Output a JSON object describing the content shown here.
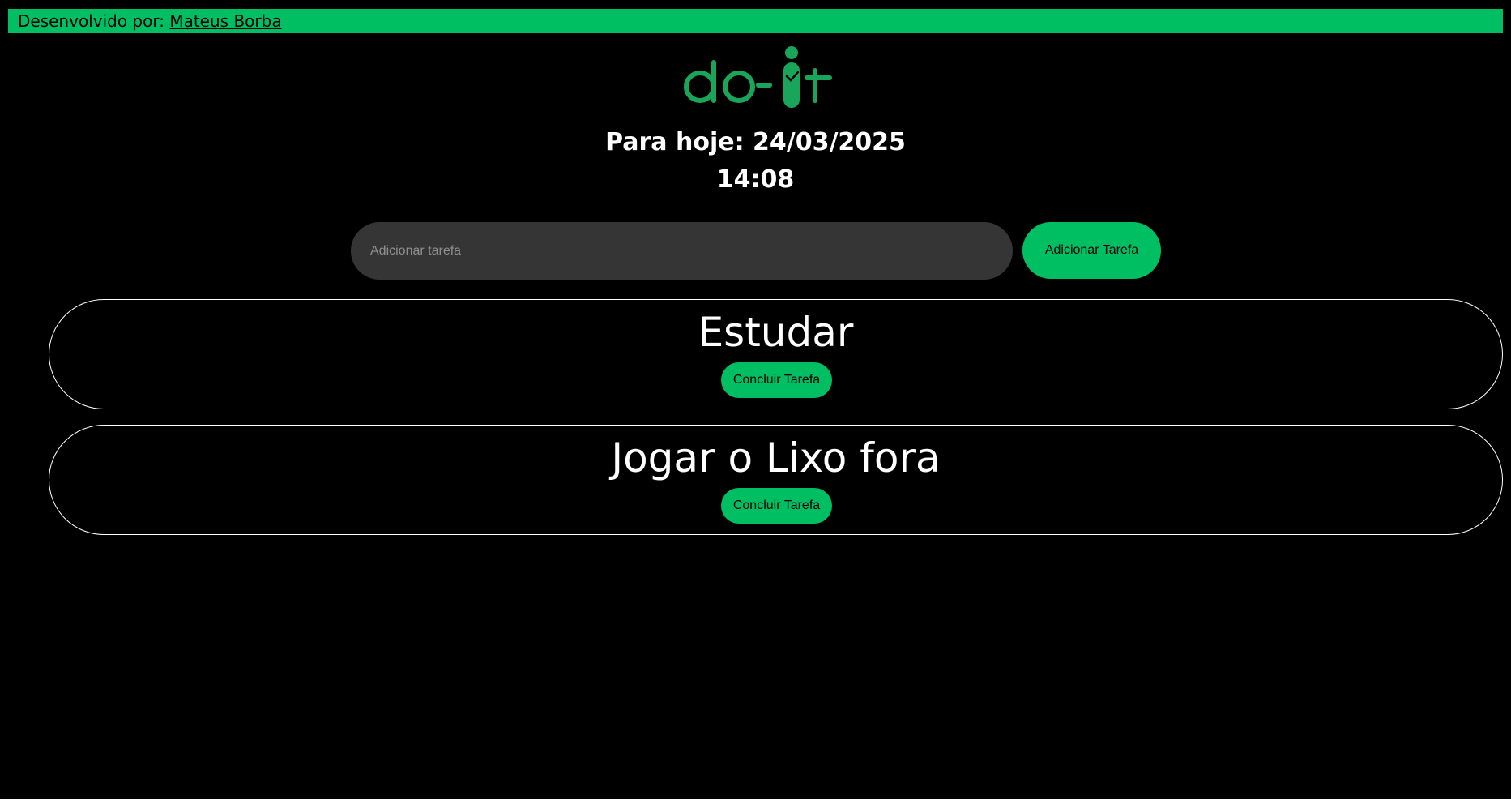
{
  "credit": {
    "prefix": "Desenvolvido por: ",
    "author": "Mateus Borba"
  },
  "logo": {
    "text": "do-it",
    "color": "#1aa65a"
  },
  "header": {
    "date_line": "Para hoje: 24/03/2025",
    "time_line": "14:08"
  },
  "form": {
    "input_value": "",
    "input_placeholder": "Adicionar tarefa",
    "add_label": "Adicionar Tarefa"
  },
  "tasks": [
    {
      "title": "Estudar",
      "action_label": "Concluir Tarefa"
    },
    {
      "title": "Jogar o Lixo fora",
      "action_label": "Concluir Tarefa"
    }
  ],
  "colors": {
    "accent": "#00bf63",
    "background": "#000000",
    "input_bg": "#353535",
    "text": "#ffffff"
  }
}
